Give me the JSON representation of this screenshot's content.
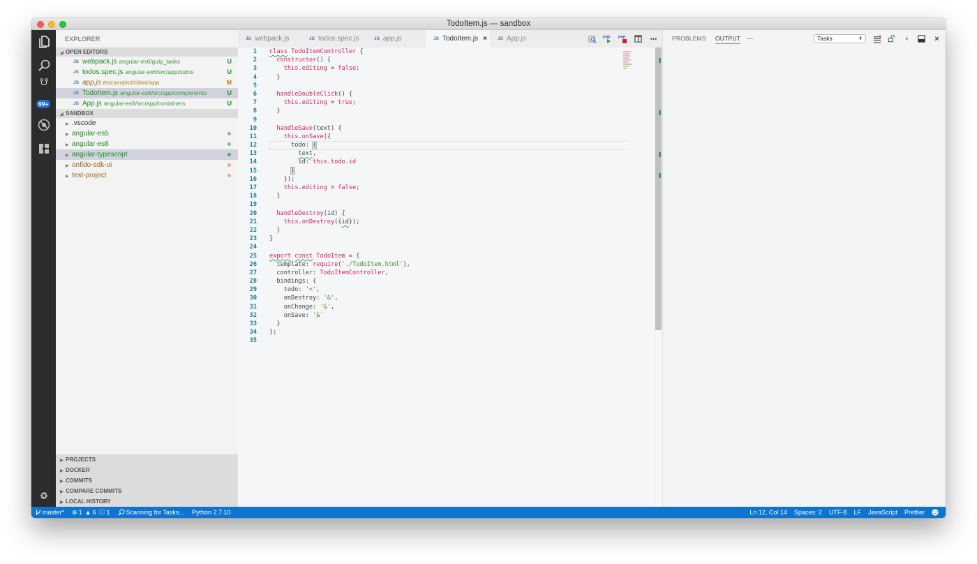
{
  "window": {
    "title": "TodoItem.js — sandbox"
  },
  "activity_bar": {
    "items": [
      {
        "name": "explorer",
        "icon": "files-icon"
      },
      {
        "name": "search",
        "icon": "search-icon"
      },
      {
        "name": "source-control",
        "icon": "source-control-icon",
        "badge": "99+"
      },
      {
        "name": "debug",
        "icon": "debug-icon"
      },
      {
        "name": "extensions",
        "icon": "extensions-icon"
      }
    ],
    "settings_icon": "gear-icon"
  },
  "sidebar": {
    "title": "EXPLORER",
    "open_editors": {
      "label": "OPEN EDITORS",
      "items": [
        {
          "tag": "JS",
          "name": "webpack.js",
          "path": "angular-es6/gulp_tasks",
          "status": "U",
          "state": "untracked",
          "selected": false,
          "italic": false
        },
        {
          "tag": "JS",
          "name": "todos.spec.js",
          "path": "angular-es6/src/app/todos",
          "status": "U",
          "state": "untracked",
          "selected": false,
          "italic": false
        },
        {
          "tag": "JS",
          "name": "app.js",
          "path": "test-project/client/app",
          "status": "M",
          "state": "modified",
          "selected": false,
          "italic": true
        },
        {
          "tag": "JS",
          "name": "TodoItem.js",
          "path": "angular-es6/src/app/components",
          "status": "U",
          "state": "untracked",
          "selected": true,
          "italic": false
        },
        {
          "tag": "JS",
          "name": "App.js",
          "path": "angular-es6/src/app/containers",
          "status": "U",
          "state": "untracked",
          "selected": false,
          "italic": false
        }
      ]
    },
    "workspace": {
      "label": "SANDBOX",
      "items": [
        {
          "name": ".vscode",
          "state": "none",
          "selected": false
        },
        {
          "name": "angular-es5",
          "state": "untracked",
          "selected": false
        },
        {
          "name": "angular-es6",
          "state": "untracked",
          "selected": false
        },
        {
          "name": "angular-typescript",
          "state": "untracked",
          "selected": true
        },
        {
          "name": "onfido-sdk-ui",
          "state": "modified",
          "selected": false
        },
        {
          "name": "test-project",
          "state": "modified",
          "selected": false
        }
      ]
    },
    "bottom_sections": [
      "PROJECTS",
      "DOCKER",
      "COMMITS",
      "COMPARE COMMITS",
      "LOCAL HISTORY"
    ]
  },
  "editor": {
    "tabs": [
      {
        "tag": "JS",
        "label": "webpack.js",
        "active": false,
        "italic": false
      },
      {
        "tag": "JS",
        "label": "todos.spec.js",
        "active": false,
        "italic": false
      },
      {
        "tag": "JS",
        "label": "app.js",
        "active": false,
        "italic": true
      },
      {
        "tag": "JS",
        "label": "TodoItem.js",
        "active": true,
        "italic": false,
        "close": "×"
      },
      {
        "tag": "JS",
        "label": "App.js",
        "active": false,
        "italic": false
      }
    ],
    "actions": [
      "open-changes-icon",
      "run-icon",
      "stop-icon",
      "split-editor-icon",
      "more-icon"
    ],
    "current_line": 12,
    "lines": [
      "class TodoItemController {",
      "  constructor() {",
      "    this.editing = false;",
      "  }",
      "",
      "  handleDoubleClick() {",
      "    this.editing = true;",
      "  }",
      "",
      "  handleSave(text) {",
      "    this.onSave({",
      "      todo: {",
      "        text,",
      "        id: this.todo.id",
      "      }",
      "    });",
      "    this.editing = false;",
      "  }",
      "",
      "  handleDestroy(id) {",
      "    this.onDestroy({id});",
      "  }",
      "}",
      "",
      "export const TodoItem = {",
      "  template: require('./TodoItem.html'),",
      "  controller: TodoItemController,",
      "  bindings: {",
      "    todo: '<',",
      "    onDestroy: '&',",
      "    onChange: '&',",
      "    onSave: '&'",
      "  }",
      "};",
      ""
    ]
  },
  "panel": {
    "tabs": [
      {
        "label": "PROBLEMS",
        "active": false
      },
      {
        "label": "OUTPUT",
        "active": true
      }
    ],
    "more": "···",
    "select_value": "Tasks",
    "actions": [
      "clear-output-icon",
      "lock-scroll-icon",
      "chevron-left-icon",
      "maximize-panel-icon",
      "close-icon"
    ]
  },
  "statusbar": {
    "branch": "master*",
    "errors": "1",
    "warnings": "6",
    "info": "1",
    "task_status": "Scanning for Tasks...",
    "interpreter": "Python 2.7.10",
    "cursor": "Ln 12, Col 14",
    "indent": "Spaces: 2",
    "encoding": "UTF-8",
    "eol": "LF",
    "language": "JavaScript",
    "formatter": "Prettier",
    "feedback_icon": "smiley-icon"
  },
  "colors": {
    "statusbar": "#0d74d0",
    "activity_bar": "#2c2c2c",
    "untracked": "#198f20",
    "modified": "#9b6a14",
    "keyword": "#d4235c",
    "string": "#4d8c17",
    "line_number": "#237893"
  }
}
